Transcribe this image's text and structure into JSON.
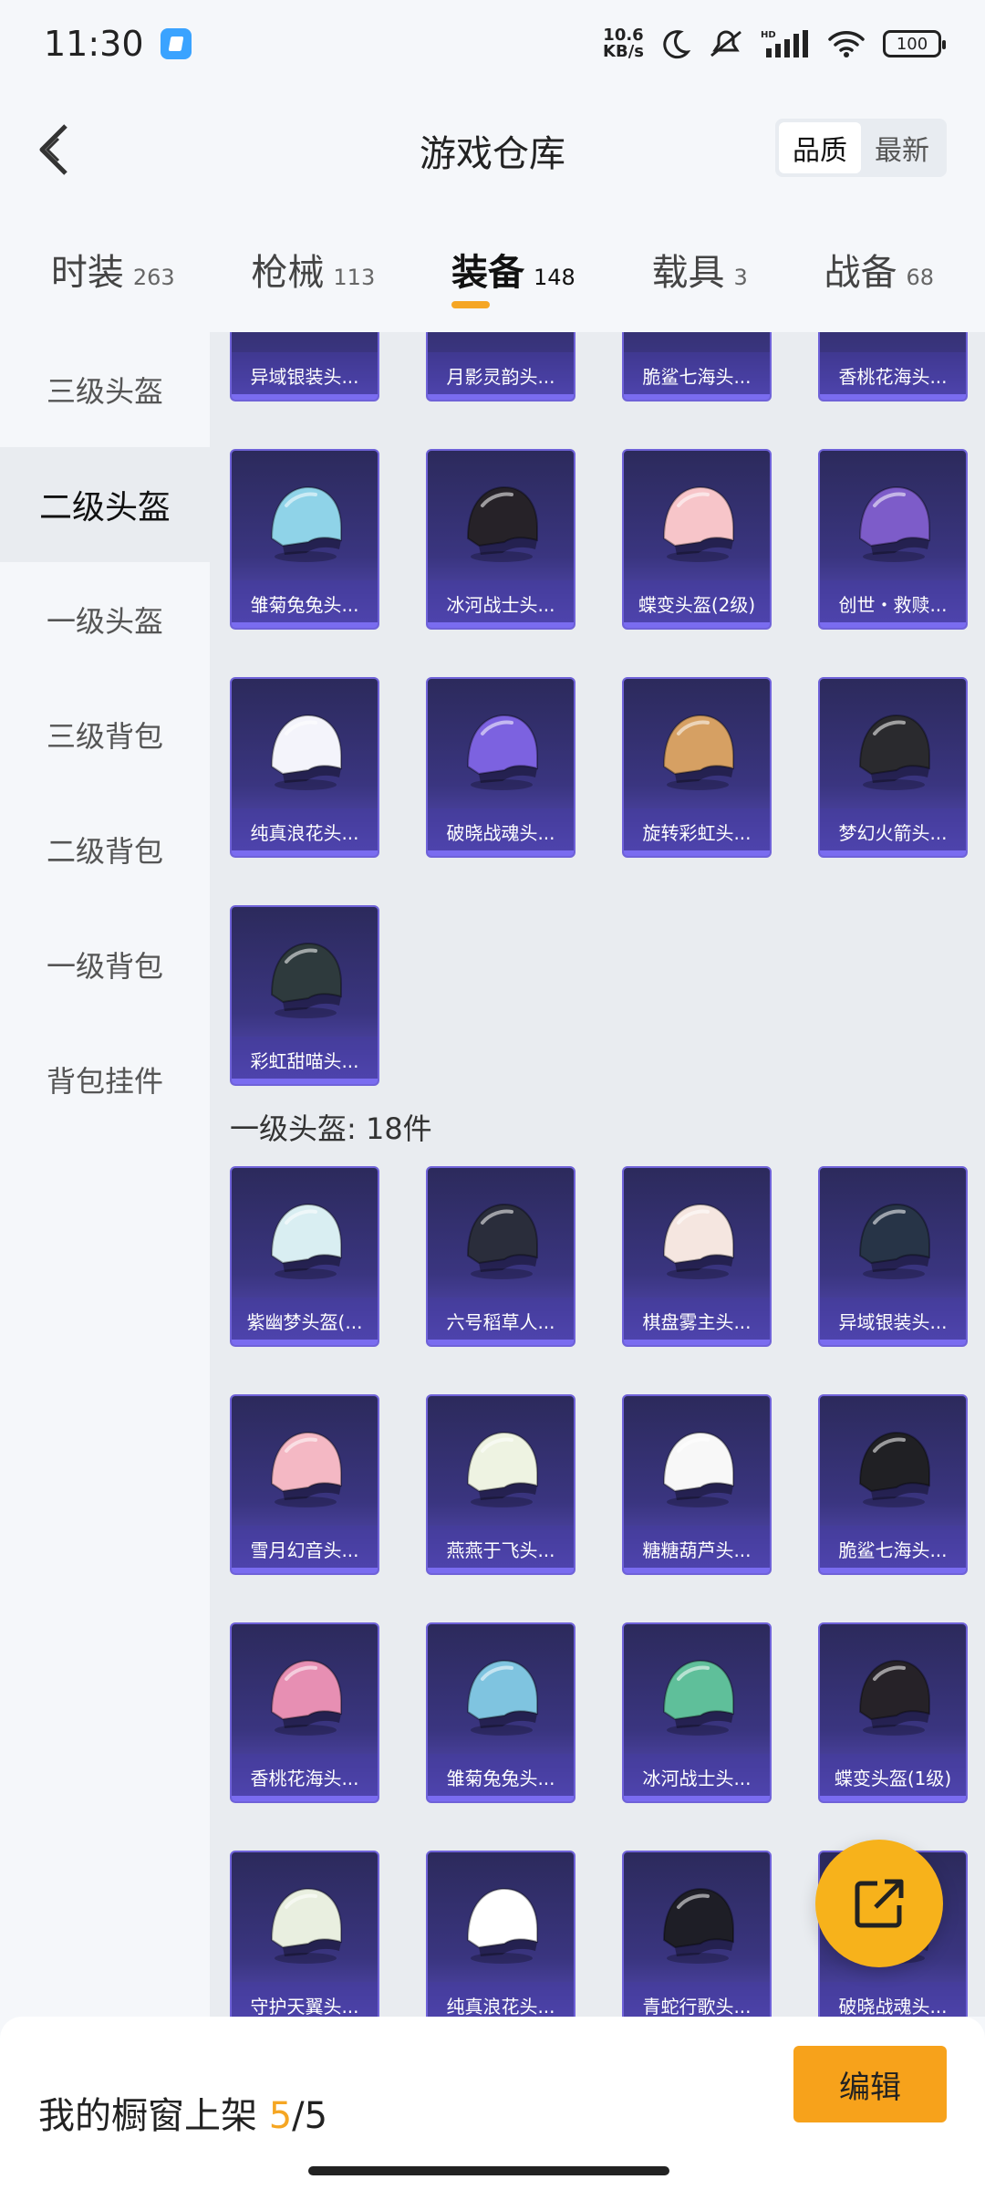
{
  "status_bar": {
    "time": "11:30",
    "net_speed_value": "10.6",
    "net_speed_unit": "KB/s",
    "battery": "100",
    "icons": [
      "moon-icon",
      "mute-icon",
      "hd-signal-icon",
      "wifi-icon",
      "battery-icon"
    ]
  },
  "header": {
    "title": "游戏仓库",
    "back_icon": "chevron-left-icon",
    "sort_options": [
      "品质",
      "最新"
    ],
    "sort_active": "品质"
  },
  "tabs": [
    {
      "label": "时装",
      "count": "263"
    },
    {
      "label": "枪械",
      "count": "113"
    },
    {
      "label": "装备",
      "count": "148",
      "active": true
    },
    {
      "label": "载具",
      "count": "3"
    },
    {
      "label": "战备",
      "count": "68"
    }
  ],
  "sidebar": {
    "items": [
      "三级头盔",
      "二级头盔",
      "一级头盔",
      "三级背包",
      "二级背包",
      "一级背包",
      "背包挂件"
    ],
    "active": "二级头盔"
  },
  "content": {
    "partial_row": [
      "异域银装头...",
      "月影灵韵头...",
      "脆鲨七海头...",
      "香桃花海头..."
    ],
    "level2_items": [
      "雏菊兔兔头...",
      "冰河战士头...",
      "蝶变头盔(2级)",
      "创世・救赎...",
      "纯真浪花头...",
      "破晓战魂头...",
      "旋转彩虹头...",
      "梦幻火箭头...",
      "彩虹甜喵头..."
    ],
    "level1_section_label": "一级头盔: 18件",
    "level1_items": [
      "紫幽梦头盔(...",
      "六号稻草人...",
      "棋盘雾主头...",
      "异域银装头...",
      "雪月幻音头...",
      "燕燕于飞头...",
      "糖糖葫芦头...",
      "脆鲨七海头...",
      "香桃花海头...",
      "雏菊兔兔头...",
      "冰河战士头...",
      "蝶变头盔(1级)",
      "守护天翼头...",
      "纯真浪花头...",
      "青蛇行歌头...",
      "破晓战魂头..."
    ]
  },
  "fab": {
    "icon": "share-external-icon"
  },
  "bottom_bar": {
    "label": "我的橱窗上架",
    "current": "5",
    "total": "/5",
    "edit_label": "编辑"
  },
  "colors": {
    "accent": "#f5a623",
    "card_top": "#2c2a5c",
    "card_bottom": "#5b4fc0"
  }
}
